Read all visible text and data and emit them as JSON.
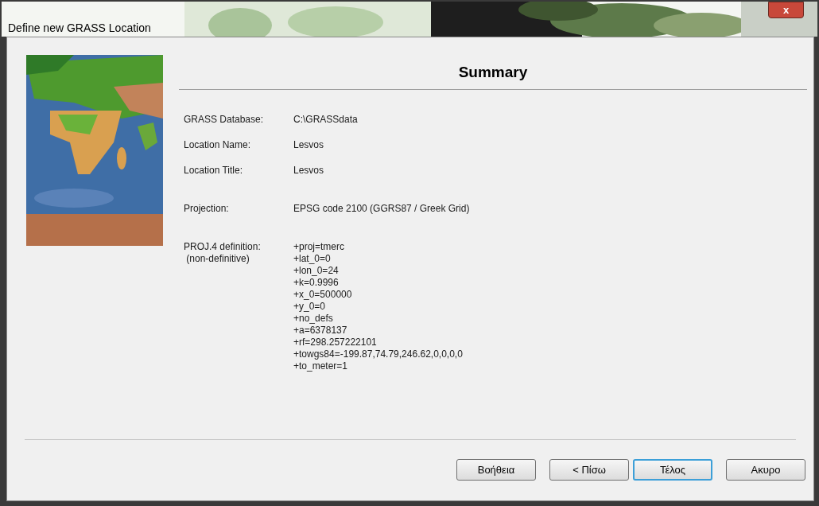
{
  "window": {
    "title": "Define new GRASS Location",
    "close_label": "x"
  },
  "heading": "Summary",
  "summary_rows": [
    {
      "label": "GRASS Database:",
      "value": [
        "C:\\GRASSdata"
      ],
      "gap_before": false
    },
    {
      "label": "Location Name:",
      "value": [
        "Lesvos"
      ],
      "gap_before": false
    },
    {
      "label": "Location Title:",
      "value": [
        "Lesvos"
      ],
      "gap_before": false
    },
    {
      "label": "Projection:",
      "value": [
        "EPSG code 2100 (GGRS87 / Greek Grid)"
      ],
      "gap_before": true
    },
    {
      "label": "PROJ.4 definition:\n (non-definitive)",
      "value": [
        "+proj=tmerc",
        "+lat_0=0",
        "+lon_0=24",
        "+k=0.9996",
        "+x_0=500000",
        "+y_0=0",
        "+no_defs",
        "+a=6378137",
        "+rf=298.257222101",
        "+towgs84=-199.87,74.79,246.62,0,0,0,0",
        "+to_meter=1"
      ],
      "gap_before": true
    }
  ],
  "buttons": [
    {
      "label": "Βοήθεια",
      "default": false
    },
    {
      "label": "< Πίσω",
      "default": false
    },
    {
      "label": "Τέλος",
      "default": true
    },
    {
      "label": "Ακυρο",
      "default": false
    }
  ]
}
